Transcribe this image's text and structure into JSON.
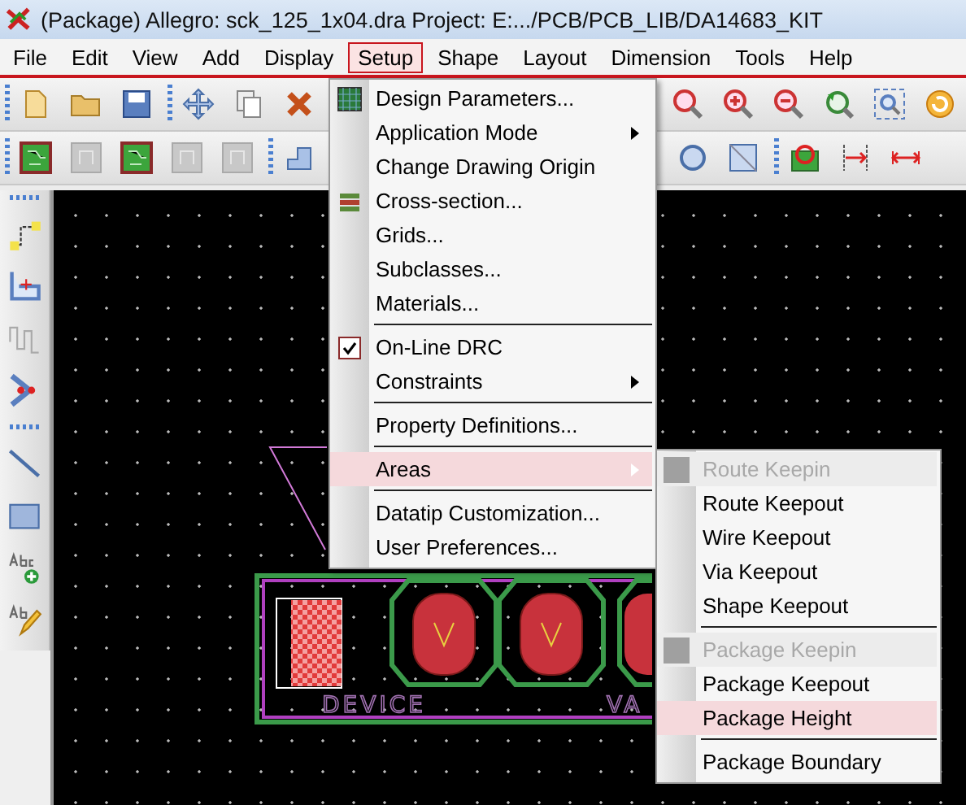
{
  "window": {
    "title": "(Package) Allegro: sck_125_1x04.dra  Project: E:.../PCB/PCB_LIB/DA14683_KIT"
  },
  "menu_bar": [
    {
      "label": "File",
      "selected": false
    },
    {
      "label": "Edit",
      "selected": false
    },
    {
      "label": "View",
      "selected": false
    },
    {
      "label": "Add",
      "selected": false
    },
    {
      "label": "Display",
      "selected": false
    },
    {
      "label": "Setup",
      "selected": true
    },
    {
      "label": "Shape",
      "selected": false
    },
    {
      "label": "Layout",
      "selected": false
    },
    {
      "label": "Dimension",
      "selected": false
    },
    {
      "label": "Tools",
      "selected": false
    },
    {
      "label": "Help",
      "selected": false
    }
  ],
  "setup_menu": [
    {
      "kind": "item",
      "label": "Design Parameters...",
      "selected": false
    },
    {
      "kind": "submenu",
      "label": "Application Mode",
      "selected": false
    },
    {
      "kind": "item",
      "label": "Change Drawing Origin",
      "selected": false
    },
    {
      "kind": "item",
      "label": "Cross-section...",
      "selected": false
    },
    {
      "kind": "item",
      "label": "Grids...",
      "selected": false
    },
    {
      "kind": "item",
      "label": "Subclasses...",
      "selected": false
    },
    {
      "kind": "item",
      "label": "Materials...",
      "selected": false
    },
    {
      "kind": "separator"
    },
    {
      "kind": "check",
      "label": "On-Line DRC",
      "checked": true,
      "selected": false
    },
    {
      "kind": "submenu",
      "label": "Constraints",
      "selected": false
    },
    {
      "kind": "separator"
    },
    {
      "kind": "item",
      "label": "Property Definitions...",
      "selected": false
    },
    {
      "kind": "separator"
    },
    {
      "kind": "submenu",
      "label": "Areas",
      "selected": true
    },
    {
      "kind": "separator"
    },
    {
      "kind": "item",
      "label": "Datatip Customization...",
      "selected": false
    },
    {
      "kind": "item",
      "label": "User Preferences...",
      "selected": false
    }
  ],
  "areas_submenu": [
    {
      "kind": "item",
      "label": "Route Keepin",
      "disabled": true,
      "selected": false
    },
    {
      "kind": "item",
      "label": "Route Keepout",
      "disabled": false,
      "selected": false
    },
    {
      "kind": "item",
      "label": "Wire Keepout",
      "disabled": false,
      "selected": false
    },
    {
      "kind": "item",
      "label": "Via Keepout",
      "disabled": false,
      "selected": false
    },
    {
      "kind": "item",
      "label": "Shape Keepout",
      "disabled": false,
      "selected": false
    },
    {
      "kind": "separator"
    },
    {
      "kind": "item",
      "label": "Package Keepin",
      "disabled": true,
      "selected": false
    },
    {
      "kind": "item",
      "label": "Package Keepout",
      "disabled": false,
      "selected": false
    },
    {
      "kind": "item",
      "label": "Package Height",
      "disabled": false,
      "selected": true
    },
    {
      "kind": "separator"
    },
    {
      "kind": "item",
      "label": "Package Boundary",
      "disabled": false,
      "selected": false
    }
  ],
  "canvas": {
    "labels": [
      "DEVICE",
      "VA"
    ]
  }
}
